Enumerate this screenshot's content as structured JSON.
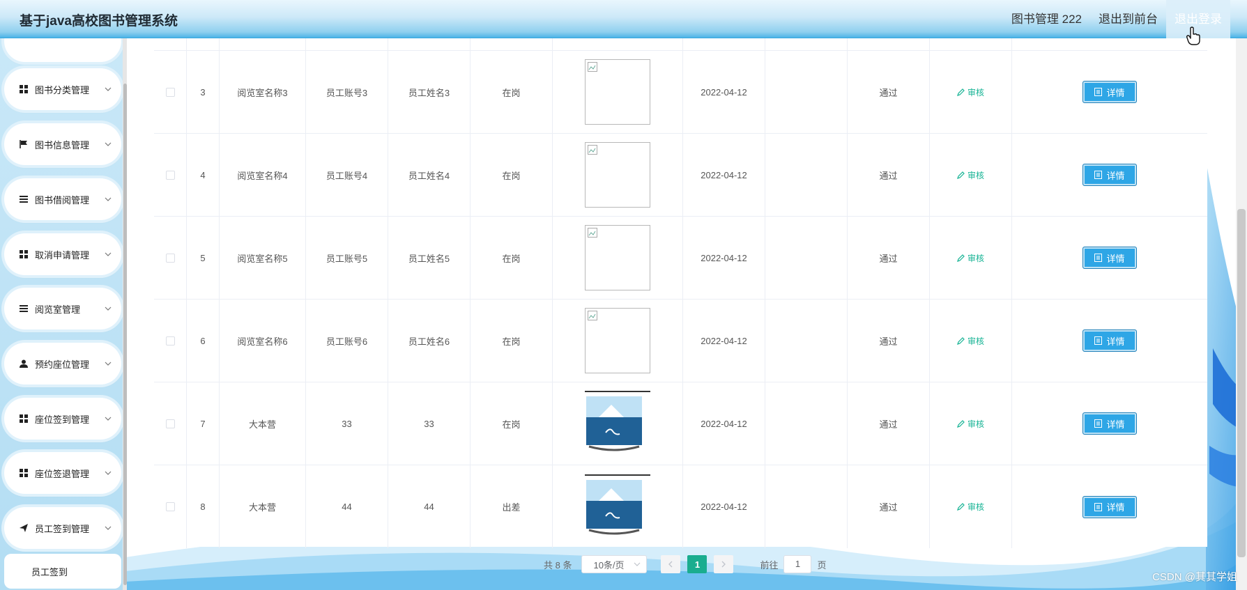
{
  "header": {
    "title": "基于java高校图书管理系统",
    "nav": [
      "图书管理 222",
      "退出到前台",
      "退出登录"
    ]
  },
  "sidebar": {
    "menus": [
      {
        "label": "图书分类管理",
        "icon": "grid-icon"
      },
      {
        "label": "图书信息管理",
        "icon": "flag-icon"
      },
      {
        "label": "图书借阅管理",
        "icon": "list-icon"
      },
      {
        "label": "取消申请管理",
        "icon": "grid-icon"
      },
      {
        "label": "阅览室管理",
        "icon": "list-icon"
      },
      {
        "label": "预约座位管理",
        "icon": "user-icon"
      },
      {
        "label": "座位签到管理",
        "icon": "grid-icon"
      },
      {
        "label": "座位签退管理",
        "icon": "grid-icon"
      },
      {
        "label": "员工签到管理",
        "icon": "send-icon"
      }
    ],
    "submenu": {
      "label": "员工签到"
    }
  },
  "table": {
    "rows": [
      {
        "index": "3",
        "room": "阅览室名称3",
        "account": "员工账号3",
        "name": "员工姓名3",
        "status": "在岗",
        "image": "broken",
        "date": "2022-04-12",
        "result": "通过",
        "audit": "审核",
        "detail": "详情"
      },
      {
        "index": "4",
        "room": "阅览室名称4",
        "account": "员工账号4",
        "name": "员工姓名4",
        "status": "在岗",
        "image": "broken",
        "date": "2022-04-12",
        "result": "通过",
        "audit": "审核",
        "detail": "详情"
      },
      {
        "index": "5",
        "room": "阅览室名称5",
        "account": "员工账号5",
        "name": "员工姓名5",
        "status": "在岗",
        "image": "broken",
        "date": "2022-04-12",
        "result": "通过",
        "audit": "审核",
        "detail": "详情"
      },
      {
        "index": "6",
        "room": "阅览室名称6",
        "account": "员工账号6",
        "name": "员工姓名6",
        "status": "在岗",
        "image": "broken",
        "date": "2022-04-12",
        "result": "通过",
        "audit": "审核",
        "detail": "详情"
      },
      {
        "index": "7",
        "room": "大本营",
        "account": "33",
        "name": "33",
        "status": "在岗",
        "image": "photo",
        "date": "2022-04-12",
        "result": "通过",
        "audit": "审核",
        "detail": "详情"
      },
      {
        "index": "8",
        "room": "大本营",
        "account": "44",
        "name": "44",
        "status": "出差",
        "image": "photo",
        "date": "2022-04-12",
        "result": "通过",
        "audit": "审核",
        "detail": "详情"
      }
    ]
  },
  "pagination": {
    "total": "共 8 条",
    "page_size": "10条/页",
    "current_page": "1",
    "goto_label": "前往",
    "goto_value": "1",
    "page_unit": "页"
  },
  "watermark": "CSDN @其其学姐",
  "colors": {
    "accent": "#2ea6e6",
    "success": "#1aad8f",
    "link": "#16b394"
  }
}
